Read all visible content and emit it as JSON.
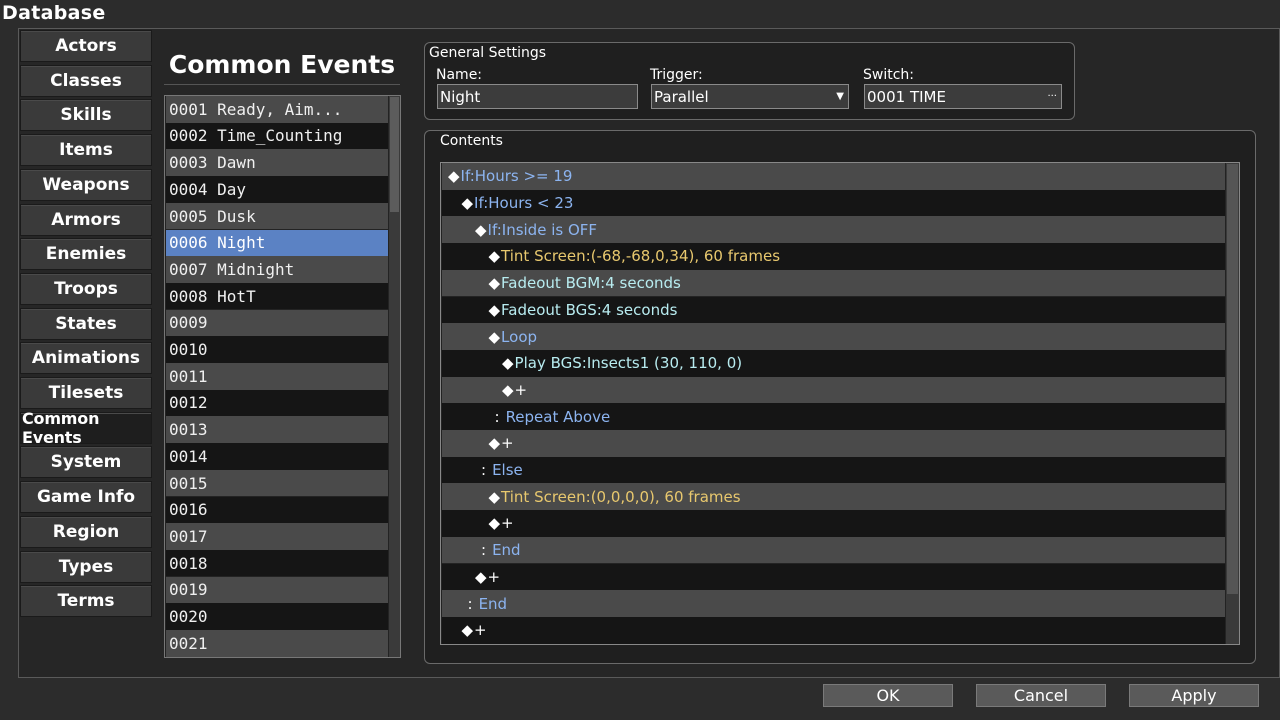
{
  "window": {
    "title": "Database"
  },
  "tabs": [
    {
      "label": "Actors"
    },
    {
      "label": "Classes"
    },
    {
      "label": "Skills"
    },
    {
      "label": "Items"
    },
    {
      "label": "Weapons"
    },
    {
      "label": "Armors"
    },
    {
      "label": "Enemies"
    },
    {
      "label": "Troops"
    },
    {
      "label": "States"
    },
    {
      "label": "Animations"
    },
    {
      "label": "Tilesets"
    },
    {
      "label": "Common Events"
    },
    {
      "label": "System"
    },
    {
      "label": "Game Info"
    },
    {
      "label": "Region"
    },
    {
      "label": "Types"
    },
    {
      "label": "Terms"
    }
  ],
  "active_tab": "Common Events",
  "events": {
    "title": "Common Events",
    "selected_index": 5,
    "items": [
      "0001 Ready, Aim...",
      "0002 Time_Counting",
      "0003 Dawn",
      "0004 Day",
      "0005 Dusk",
      "0006 Night",
      "0007 Midnight",
      "0008 HotT",
      "0009",
      "0010",
      "0011",
      "0012",
      "0013",
      "0014",
      "0015",
      "0016",
      "0017",
      "0018",
      "0019",
      "0020",
      "0021"
    ]
  },
  "general": {
    "title": "General Settings",
    "name_label": "Name:",
    "name_value": "Night",
    "trigger_label": "Trigger:",
    "trigger_value": "Parallel",
    "switch_label": "Switch:",
    "switch_value": "0001 TIME"
  },
  "contents": {
    "title": "Contents",
    "commands": [
      {
        "indent": 0,
        "text": "If:Hours >= 19",
        "color": "blue",
        "marker": "◆"
      },
      {
        "indent": 1,
        "text": "If:Hours < 23",
        "color": "blue",
        "marker": "◆"
      },
      {
        "indent": 2,
        "text": "If:Inside is OFF",
        "color": "blue",
        "marker": "◆"
      },
      {
        "indent": 3,
        "text": "Tint Screen:(-68,-68,0,34), 60 frames",
        "color": "yellow",
        "marker": "◆"
      },
      {
        "indent": 3,
        "text": "Fadeout BGM:4 seconds",
        "color": "teal",
        "marker": "◆"
      },
      {
        "indent": 3,
        "text": "Fadeout BGS:4 seconds",
        "color": "teal",
        "marker": "◆"
      },
      {
        "indent": 3,
        "text": "Loop",
        "color": "blue",
        "marker": "◆"
      },
      {
        "indent": 4,
        "text": "Play BGS:Insects1 (30, 110, 0)",
        "color": "teal",
        "marker": "◆"
      },
      {
        "indent": 4,
        "text": "+",
        "color": "white",
        "marker": "◆"
      },
      {
        "indent": 3,
        "text": "Repeat Above",
        "color": "blue",
        "marker": ":"
      },
      {
        "indent": 3,
        "text": "+",
        "color": "white",
        "marker": "◆"
      },
      {
        "indent": 2,
        "text": "Else",
        "color": "blue",
        "marker": ":"
      },
      {
        "indent": 3,
        "text": "Tint Screen:(0,0,0,0), 60 frames",
        "color": "yellow",
        "marker": "◆"
      },
      {
        "indent": 3,
        "text": "+",
        "color": "white",
        "marker": "◆"
      },
      {
        "indent": 2,
        "text": "End",
        "color": "blue",
        "marker": ":"
      },
      {
        "indent": 2,
        "text": "+",
        "color": "white",
        "marker": "◆"
      },
      {
        "indent": 1,
        "text": "End",
        "color": "blue",
        "marker": ":"
      },
      {
        "indent": 1,
        "text": "+",
        "color": "white",
        "marker": "◆"
      }
    ]
  },
  "buttons": {
    "ok": "OK",
    "cancel": "Cancel",
    "apply": "Apply"
  },
  "colors": {
    "selection": "#5b82c4",
    "blue_text": "#8cb4f0",
    "yellow_text": "#e8c86e",
    "teal_text": "#b8ecf0"
  },
  "icons": {
    "dropdown": "chevron-down-icon",
    "ellipsis": "ellipsis-icon",
    "command_marker": "diamond-icon"
  }
}
